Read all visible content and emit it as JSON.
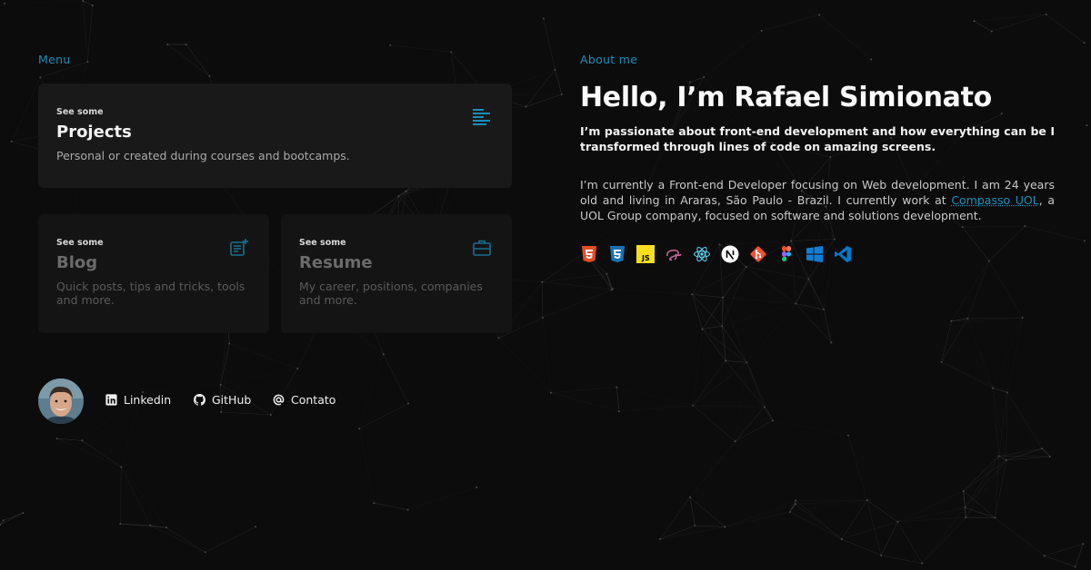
{
  "menu": {
    "label": "Menu",
    "cards": [
      {
        "kicker": "See some",
        "title": "Projects",
        "desc": "Personal or created during courses and bootcamps.",
        "icon": "list-align-icon"
      },
      {
        "kicker": "See some",
        "title": "Blog",
        "desc": "Quick posts, tips and tricks, tools and more.",
        "icon": "note-add-icon"
      },
      {
        "kicker": "See some",
        "title": "Resume",
        "desc": "My career, positions, companies and more.",
        "icon": "briefcase-icon"
      }
    ]
  },
  "social": [
    {
      "label": "Linkedin",
      "icon": "linkedin-icon"
    },
    {
      "label": "GitHub",
      "icon": "github-icon"
    },
    {
      "label": "Contato",
      "icon": "at-icon"
    }
  ],
  "about": {
    "label": "About me",
    "title": "Hello, I’m Rafael Simionato",
    "intro": "I’m passionate about front-end development and how everything can be I transformed through lines of code on amazing screens.",
    "body_before": "I’m currently a Front-end Developer focusing on Web development. I am 24 years old and living in Araras, São Paulo - Brazil. I currently work at ",
    "link_text": "Compasso UOL",
    "body_after": ", a UOL Group company, focused on software and solutions development."
  },
  "tech_icons": [
    "html5-icon",
    "css3-icon",
    "javascript-icon",
    "sass-icon",
    "react-icon",
    "nextjs-icon",
    "git-icon",
    "figma-icon",
    "windows-icon",
    "vscode-icon"
  ],
  "colors": {
    "accent": "#1a8fb8",
    "background": "#0c0c0d",
    "card": "#19191a"
  }
}
